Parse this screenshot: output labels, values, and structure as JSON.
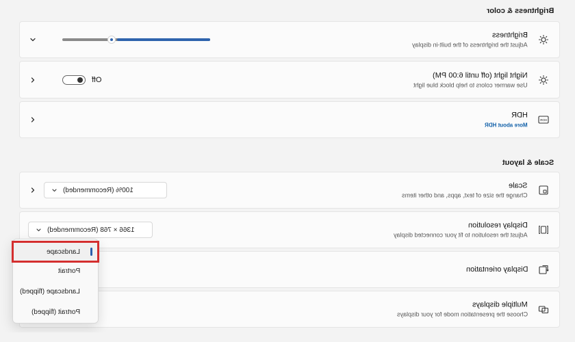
{
  "sections": {
    "brightness_color": "Brightness & color",
    "scale_layout": "Scale & layout"
  },
  "cards": {
    "brightness": {
      "title": "Brightness",
      "subtitle": "Adjust the brightness of the built-in display",
      "icon": "sun-icon",
      "slider_value_percent": 31
    },
    "night_light": {
      "title": "Night light (off until 6:00 PM)",
      "subtitle": "Use warmer colors to help block blue light",
      "state_label": "Off",
      "icon": "sun-icon"
    },
    "hdr": {
      "title": "HDR",
      "link": "More about HDR",
      "icon": "hdr-icon"
    },
    "scale": {
      "title": "Scale",
      "subtitle": "Change the size of text, apps, and other items",
      "value": "100% (Recommended)",
      "icon": "scale-icon"
    },
    "display_resolution": {
      "title": "Display resolution",
      "subtitle": "Adjust the resolution to fit your connected display",
      "value": "1366 × 768 (Recommended)",
      "icon": "resolution-icon"
    },
    "display_orientation": {
      "title": "Display orientation",
      "icon": "orientation-icon"
    },
    "multiple_displays": {
      "title": "Multiple displays",
      "subtitle": "Choose the presentation mode for your displays",
      "icon": "multiple-displays-icon"
    }
  },
  "orientation_menu": {
    "items": [
      "Landscape",
      "Portrait",
      "Landscape (flipped)",
      "Portrait (flipped)"
    ],
    "selected": "Landscape"
  },
  "colors": {
    "accent": "#2f64ad",
    "highlight": "#d42f2f"
  }
}
